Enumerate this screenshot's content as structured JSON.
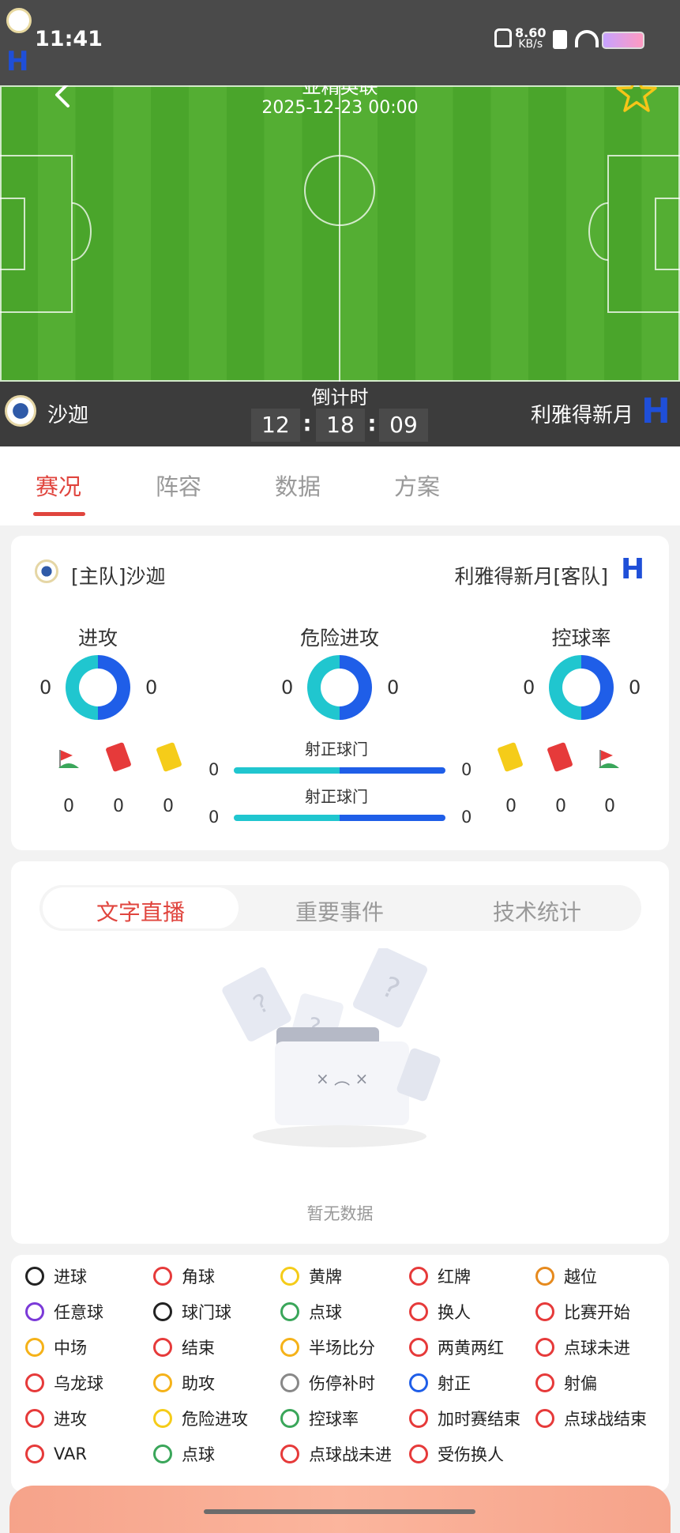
{
  "status_bar": {
    "time": "11:41",
    "net_speed": "8.60",
    "net_unit": "KB/s"
  },
  "match": {
    "competition": "亚精英联",
    "datetime": "2025-12-23 00:00"
  },
  "scorebar": {
    "home_name": "沙迦",
    "away_name": "利雅得新月",
    "countdown_label": "倒计时",
    "countdown": {
      "h": "12",
      "m": "18",
      "s": "09"
    },
    "sep": ":"
  },
  "tabs": [
    "赛况",
    "阵容",
    "数据",
    "方案"
  ],
  "stats_card": {
    "home_label": "[主队]沙迦",
    "away_label": "利雅得新月[客队]",
    "attack": {
      "label": "进攻",
      "home": "0",
      "away": "0"
    },
    "danger": {
      "label": "危险进攻",
      "home": "0",
      "away": "0"
    },
    "possession": {
      "label": "控球率",
      "home": "0",
      "away": "0"
    },
    "home_cards": [
      "0",
      "0",
      "0"
    ],
    "away_cards": [
      "0",
      "0",
      "0"
    ],
    "bar1": {
      "label": "射正球门",
      "home": "0",
      "away": "0"
    },
    "bar2": {
      "label": "射正球门",
      "home": "0",
      "away": "0"
    }
  },
  "live_tabs": [
    "文字直播",
    "重要事件",
    "技术统计"
  ],
  "empty_text": "暂无数据",
  "legend": [
    [
      "进球",
      "角球",
      "黄牌",
      "红牌",
      "越位"
    ],
    [
      "任意球",
      "球门球",
      "点球",
      "换人",
      "比赛开始"
    ],
    [
      "中场",
      "结束",
      "半场比分",
      "两黄两红",
      "点球未进"
    ],
    [
      "乌龙球",
      "助攻",
      "伤停补时",
      "射正",
      "射偏"
    ],
    [
      "进攻",
      "危险进攻",
      "控球率",
      "加时赛结束",
      "点球战结束"
    ],
    [
      "VAR",
      "点球",
      "点球战未进",
      "受伤换人"
    ]
  ],
  "colors": {
    "accent": "#e0453e",
    "home_bar": "#20c6cf",
    "away_bar": "#1f5ee8",
    "pitch": "#4aa52b"
  }
}
